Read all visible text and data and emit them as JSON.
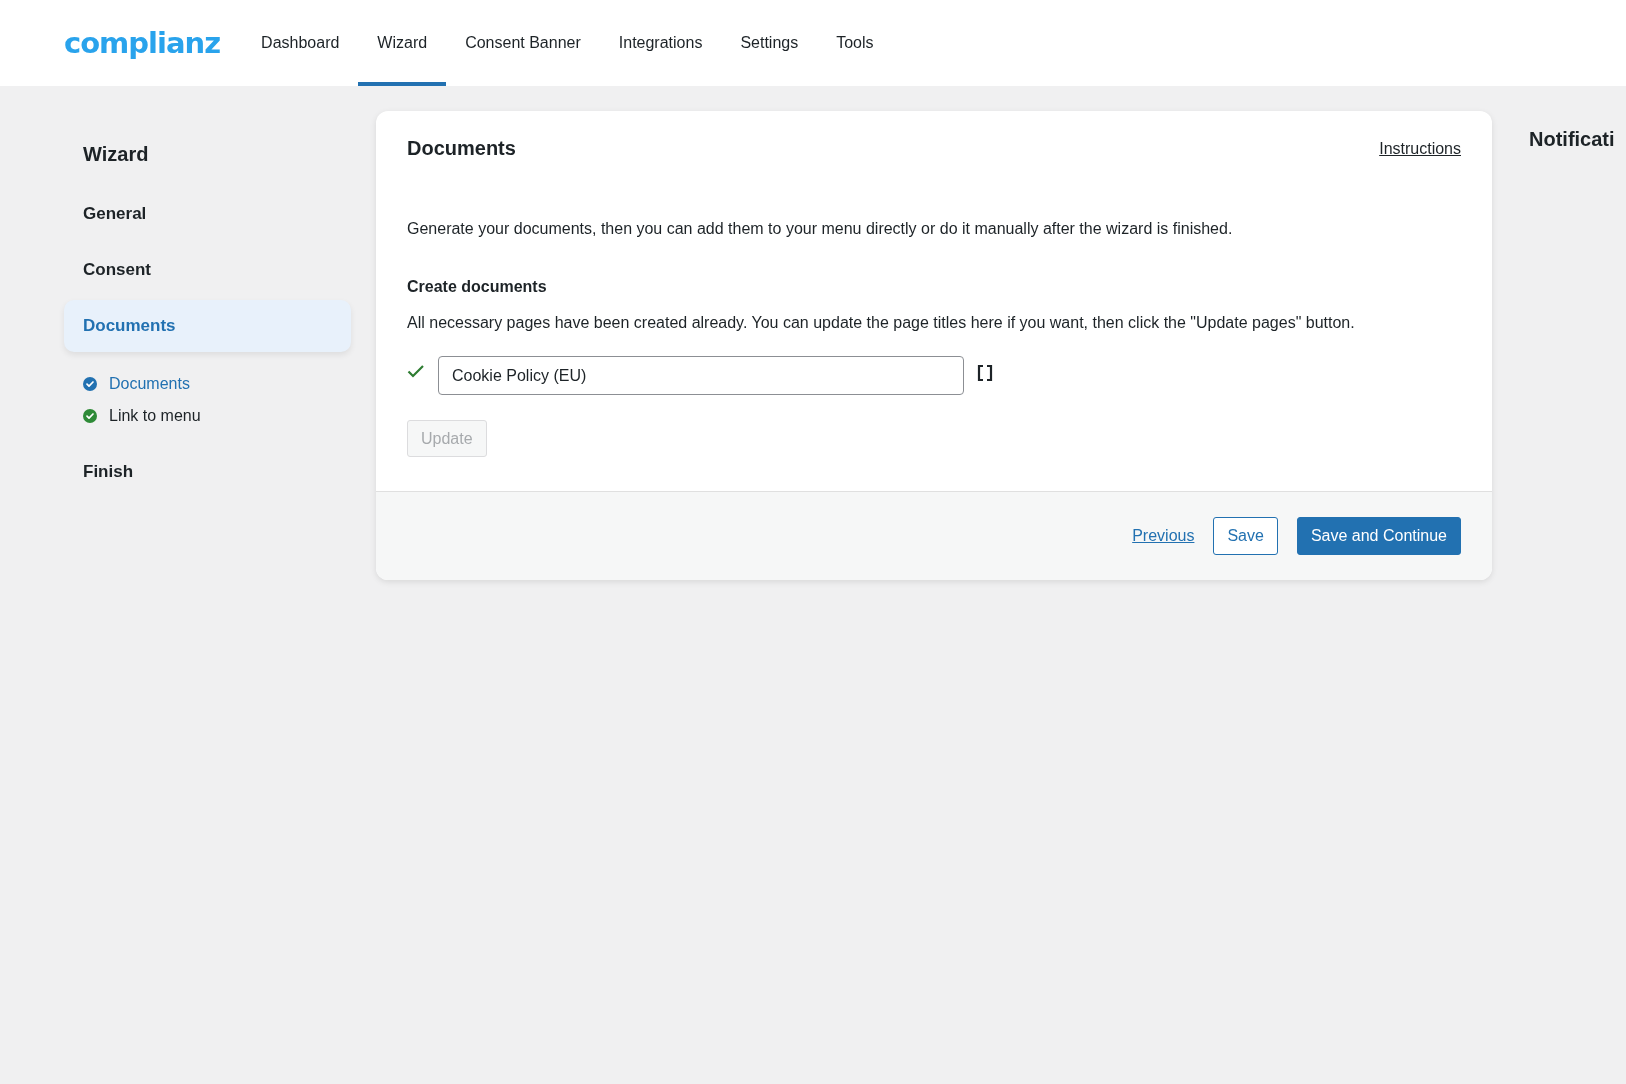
{
  "header": {
    "logo": "complianz",
    "tabs": [
      {
        "label": "Dashboard",
        "selected": false
      },
      {
        "label": "Wizard",
        "selected": true
      },
      {
        "label": "Consent Banner",
        "selected": false
      },
      {
        "label": "Integrations",
        "selected": false
      },
      {
        "label": "Settings",
        "selected": false
      },
      {
        "label": "Tools",
        "selected": false
      }
    ]
  },
  "sidebar": {
    "title": "Wizard",
    "steps": [
      {
        "label": "General",
        "selected": false
      },
      {
        "label": "Consent",
        "selected": false
      },
      {
        "label": "Documents",
        "selected": true,
        "children": [
          {
            "label": "Documents",
            "selected": true,
            "color": "#2271b1"
          },
          {
            "label": "Link to menu",
            "selected": false,
            "color": "#2e8a37"
          }
        ]
      },
      {
        "label": "Finish",
        "selected": false
      }
    ]
  },
  "card": {
    "title": "Documents",
    "instructions_link": "Instructions",
    "intro": "Generate your documents, then you can add them to your menu directly or do it manually after the wizard is finished.",
    "section_title": "Create documents",
    "section_text": "All necessary pages have been created already. You can update the page titles here if you want, then click the \"Update pages\" button.",
    "pages": [
      {
        "value": "Cookie Policy (EU)",
        "valid": true
      }
    ],
    "update_button": {
      "label": "Update",
      "disabled": true
    },
    "footer": {
      "previous": "Previous",
      "save": "Save",
      "save_continue": "Save and Continue"
    }
  },
  "notifications": {
    "title": "Notificati"
  }
}
